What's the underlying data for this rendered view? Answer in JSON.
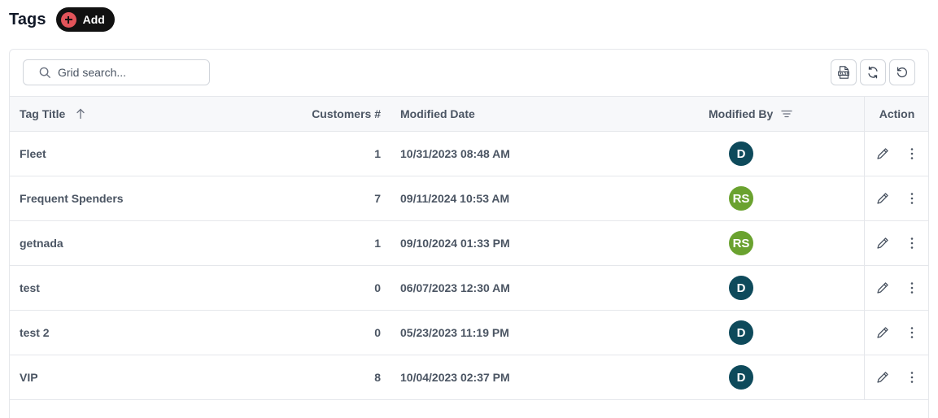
{
  "page": {
    "title": "Tags",
    "add_label": "Add"
  },
  "search": {
    "placeholder": "Grid search..."
  },
  "columns": {
    "tag_title": "Tag Title",
    "customers": "Customers #",
    "modified_date": "Modified Date",
    "modified_by": "Modified By",
    "action": "Action"
  },
  "rows": [
    {
      "title": "Fleet",
      "customers": "1",
      "modified_date": "10/31/2023 08:48 AM",
      "modified_by": "D",
      "avatar_color": "#0e4a5b"
    },
    {
      "title": "Frequent Spenders",
      "customers": "7",
      "modified_date": "09/11/2024 10:53 AM",
      "modified_by": "RS",
      "avatar_color": "#6aa22f"
    },
    {
      "title": "getnada",
      "customers": "1",
      "modified_date": "09/10/2024 01:33 PM",
      "modified_by": "RS",
      "avatar_color": "#6aa22f"
    },
    {
      "title": "test",
      "customers": "0",
      "modified_date": "06/07/2023 12:30 AM",
      "modified_by": "D",
      "avatar_color": "#0e4a5b"
    },
    {
      "title": "test 2",
      "customers": "0",
      "modified_date": "05/23/2023 11:19 PM",
      "modified_by": "D",
      "avatar_color": "#0e4a5b"
    },
    {
      "title": "VIP",
      "customers": "8",
      "modified_date": "10/04/2023 02:37 PM",
      "modified_by": "D",
      "avatar_color": "#0e4a5b"
    }
  ],
  "icons": {
    "add": "plus-circle-icon",
    "search": "search-icon",
    "export": "xlsx-export-icon",
    "refresh": "refresh-icon",
    "reset": "reset-icon",
    "sort": "arrow-up-icon",
    "filter": "filter-icon",
    "edit": "pencil-icon",
    "more": "kebab-icon"
  }
}
